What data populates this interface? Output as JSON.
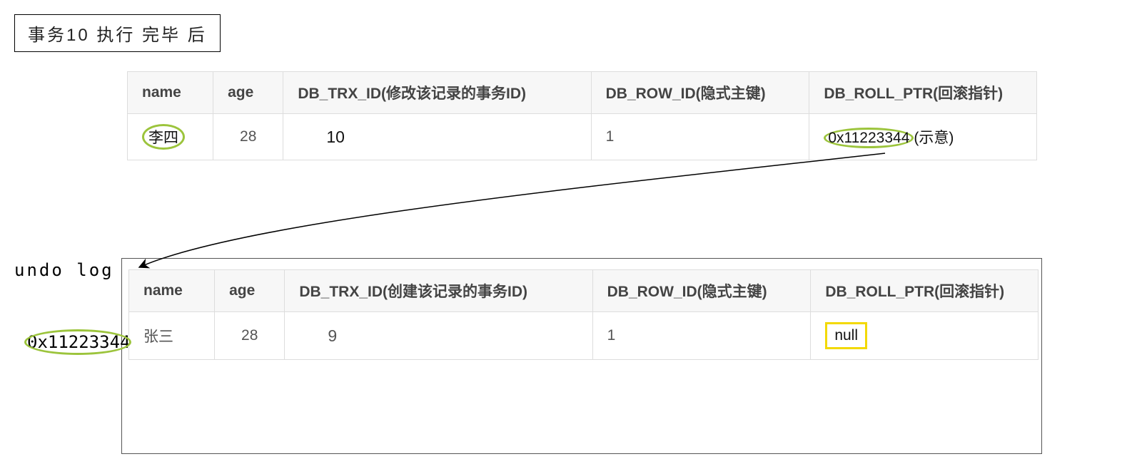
{
  "title": "事务10 执行 完毕 后",
  "undo_log_label": "undo log",
  "undo_address": "0x11223344",
  "table1": {
    "headers": {
      "name": "name",
      "age": "age",
      "trx_id": "DB_TRX_ID(修改该记录的事务ID)",
      "row_id": "DB_ROW_ID(隐式主键)",
      "roll_ptr": "DB_ROLL_PTR(回滚指针)"
    },
    "row": {
      "name": "李四",
      "age": "28",
      "trx_id": "10",
      "row_id": "1",
      "roll_ptr_addr": "0x11223344",
      "roll_ptr_note": "(示意)"
    }
  },
  "table2": {
    "headers": {
      "name": "name",
      "age": "age",
      "trx_id": "DB_TRX_ID(创建该记录的事务ID)",
      "row_id": "DB_ROW_ID(隐式主键)",
      "roll_ptr": "DB_ROLL_PTR(回滚指针)"
    },
    "row": {
      "name": "张三",
      "age": "28",
      "trx_id": "9",
      "row_id": "1",
      "roll_ptr": "null"
    }
  }
}
